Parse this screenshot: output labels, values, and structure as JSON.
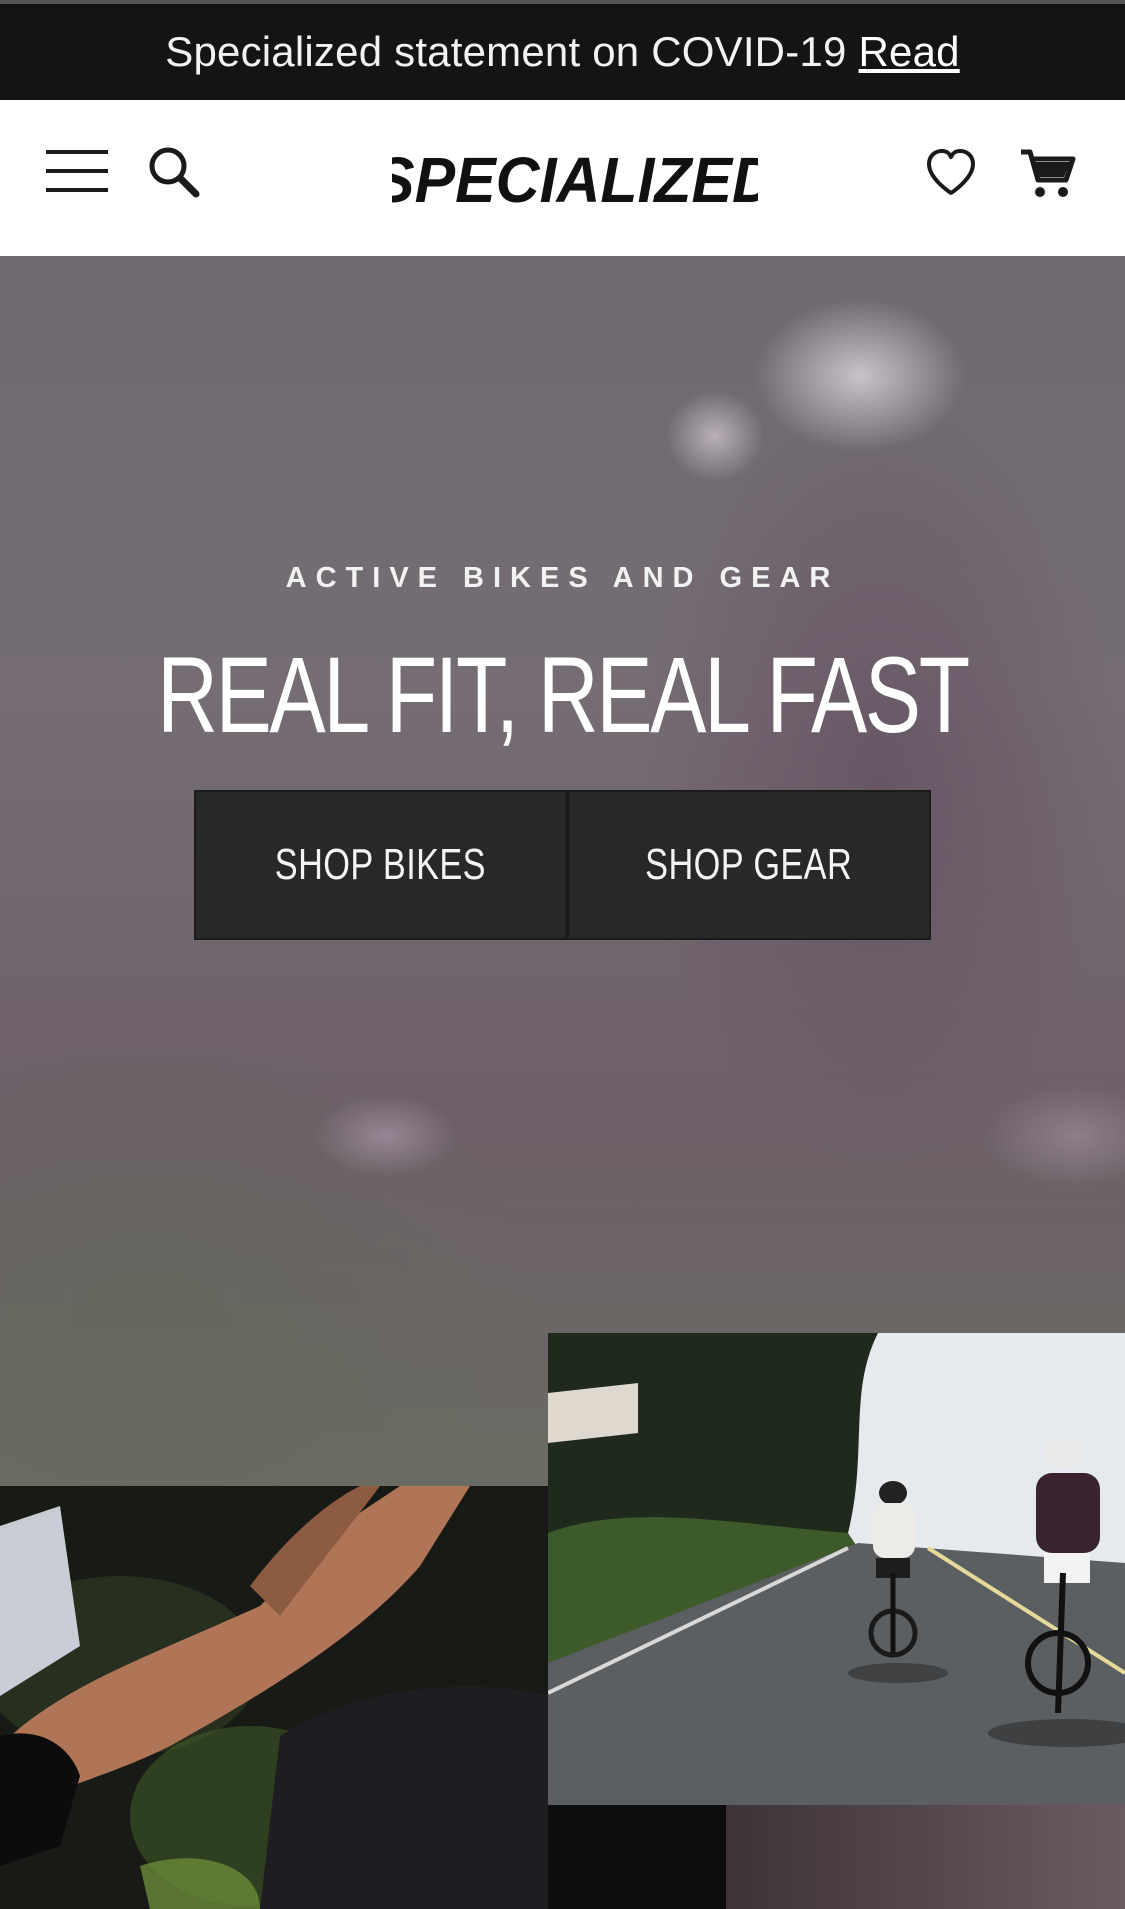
{
  "announcement": {
    "text": "Specialized statement on COVID-19",
    "link_label": "Read"
  },
  "header": {
    "logo_text": "SPECIALIZED",
    "icons": [
      "menu-icon",
      "search-icon",
      "heart-icon",
      "cart-icon"
    ]
  },
  "hero": {
    "eyebrow": "ACTIVE BIKES AND GEAR",
    "headline": "REAL FIT, REAL FAST",
    "buttons": [
      {
        "label": "SHOP BIKES"
      },
      {
        "label": "SHOP GEAR"
      }
    ]
  },
  "colors": {
    "announcement_bg": "#141414",
    "header_bg": "#ffffff",
    "button_bg": "#282828",
    "text_light": "#ffffff"
  }
}
